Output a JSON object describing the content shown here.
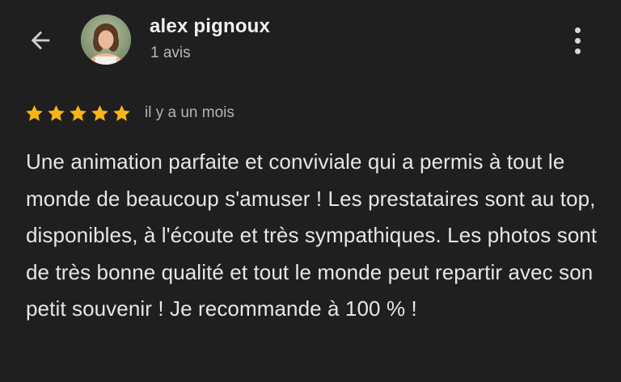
{
  "header": {
    "back_icon": "arrow-back-icon",
    "avatar_icon": "user-avatar-photo",
    "name": "alex pignoux",
    "review_count": "1 avis",
    "more_icon": "more-vertical-icon"
  },
  "review": {
    "rating": 5,
    "rating_max": 5,
    "star_color": "#f9b516",
    "time": "il y a un mois",
    "text": "Une animation parfaite et conviviale qui a permis à tout le monde de beaucoup s'amuser ! Les prestataires sont au top, disponibles, à l'écoute et très sympathiques. Les photos sont de très bonne qualité et tout le monde peut repartir avec son petit souvenir ! Je recommande à 100 % !"
  }
}
